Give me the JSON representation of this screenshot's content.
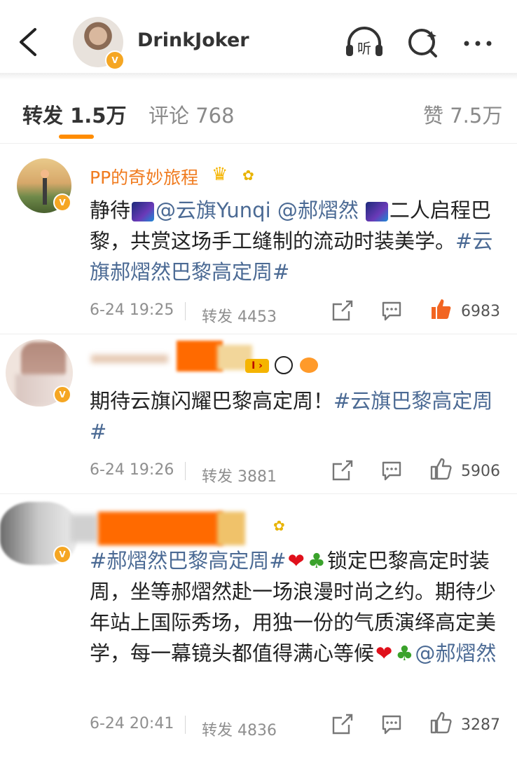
{
  "header": {
    "username": "DrinkJoker",
    "listen_icon_text": "听"
  },
  "tabs": [
    {
      "label": "转发 1.5万",
      "active": true
    },
    {
      "label": "评论 768",
      "active": false
    },
    {
      "label": "赞 7.5万",
      "active": false
    }
  ],
  "posts": [
    {
      "username": "PP的奇妙旅程",
      "text_parts": [
        "静待",
        "@云旗Yunqi",
        " ",
        "@郝熠然",
        "二人启程巴黎，共赏这场手工缝制的流动时装美学。",
        "#云旗郝熠然巴黎高定周#"
      ],
      "time": "6-24 19:25",
      "repost_label": "转发 4453",
      "likes": "6983",
      "liked": true
    },
    {
      "username": "",
      "text_parts": [
        "期待云旗闪耀巴黎高定周！",
        "#云旗巴黎高定周#"
      ],
      "time": "6-24 19:26",
      "repost_label": "转发 3881",
      "likes": "5906",
      "liked": false
    },
    {
      "username": "",
      "text_parts": [
        "#郝熠然巴黎高定周#",
        "锁定巴黎高定时装周，坐等郝熠然赴一场浪漫时尚之约。期待少年站上国际秀场，用独一份的气质演绎高定美学，每一幕镜头都值得满心等候",
        "@郝熠然"
      ],
      "time": "6-24 20:41",
      "repost_label": "转发 4836",
      "likes": "3287",
      "liked": false
    }
  ],
  "colors": {
    "accent": "#ff8c00",
    "link": "#4b6a94",
    "username_orange": "#f07b1f",
    "verified": "#f5a623",
    "liked": "#f26522"
  }
}
